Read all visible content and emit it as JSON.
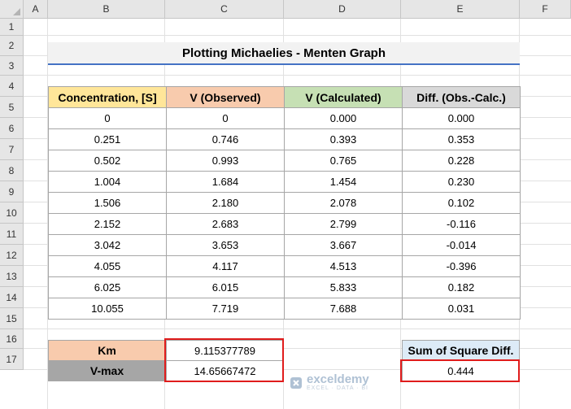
{
  "columns": [
    "A",
    "B",
    "C",
    "D",
    "E",
    "F"
  ],
  "rows": [
    "1",
    "2",
    "3",
    "4",
    "5",
    "6",
    "7",
    "8",
    "9",
    "10",
    "11",
    "12",
    "13",
    "14",
    "15",
    "16",
    "17"
  ],
  "title": "Plotting Michaelies - Menten Graph",
  "table": {
    "headers": [
      "Concentration, [S]",
      "V (Observed)",
      "V (Calculated)",
      "Diff. (Obs.-Calc.)"
    ],
    "header_colors": [
      "#ffe699",
      "#f8cbad",
      "#c6e0b4",
      "#d9d9d9"
    ],
    "rows": [
      [
        "0",
        "0",
        "0.000",
        "0.000"
      ],
      [
        "0.251",
        "0.746",
        "0.393",
        "0.353"
      ],
      [
        "0.502",
        "0.993",
        "0.765",
        "0.228"
      ],
      [
        "1.004",
        "1.684",
        "1.454",
        "0.230"
      ],
      [
        "1.506",
        "2.180",
        "2.078",
        "0.102"
      ],
      [
        "2.152",
        "2.683",
        "2.799",
        "-0.116"
      ],
      [
        "3.042",
        "3.653",
        "3.667",
        "-0.014"
      ],
      [
        "4.055",
        "4.117",
        "4.513",
        "-0.396"
      ],
      [
        "6.025",
        "6.015",
        "5.833",
        "0.182"
      ],
      [
        "10.055",
        "7.719",
        "7.688",
        "0.031"
      ]
    ]
  },
  "params": {
    "km_label": "Km",
    "km_value": "9.115377789",
    "vmax_label": "V-max",
    "vmax_value": "14.65667472",
    "km_color": "#f8cbad",
    "vmax_color": "#a6a6a6"
  },
  "ssd": {
    "label": "Sum of Square Diff.",
    "value": "0.444",
    "color": "#ddebf7"
  },
  "highlight_color": "#e01c1c",
  "watermark": {
    "name": "exceldemy",
    "tagline": "EXCEL · DATA · BI"
  }
}
